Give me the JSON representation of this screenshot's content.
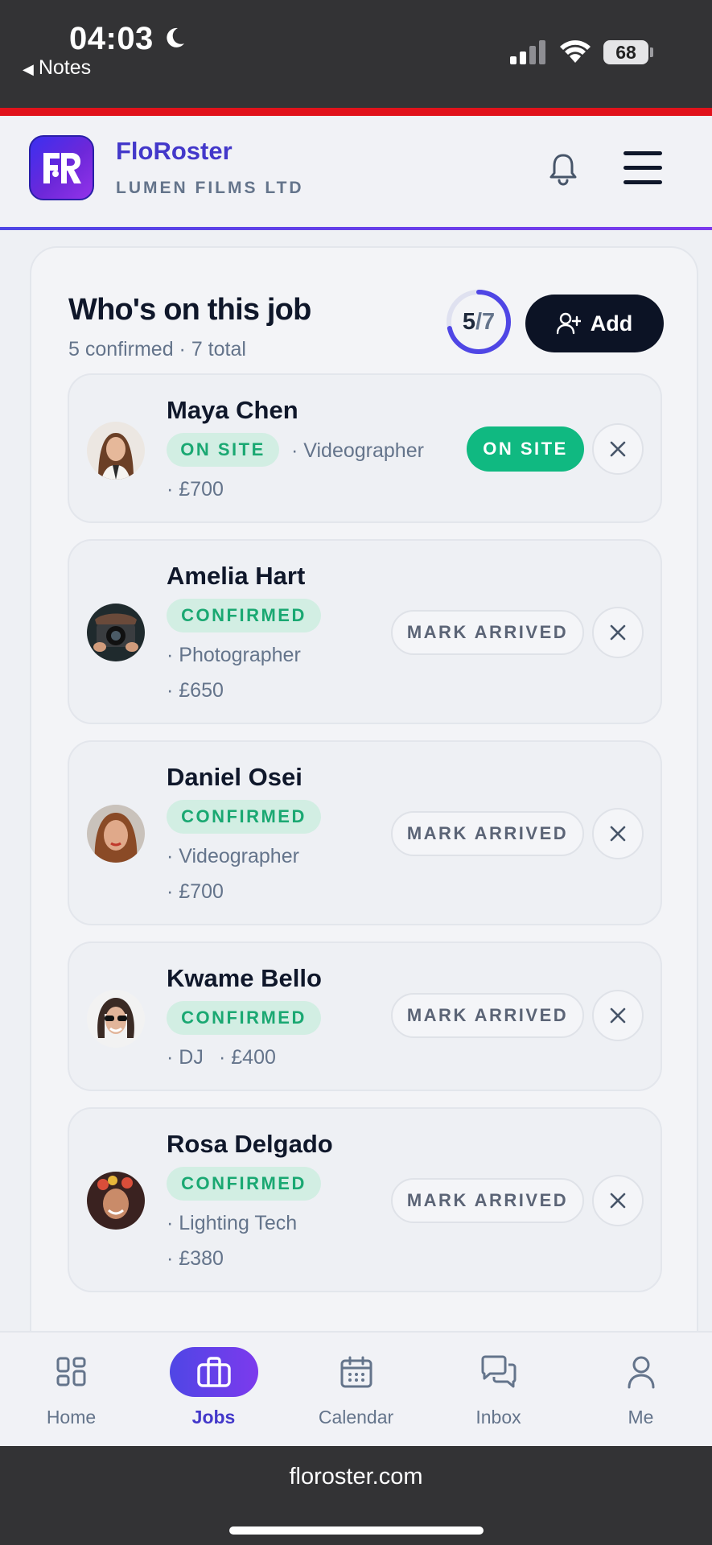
{
  "status_bar": {
    "time": "04:03",
    "back_app": "Notes",
    "battery": "68"
  },
  "header": {
    "brand": "FloRoster",
    "company": "LUMEN FILMS LTD",
    "logo_text": "FR",
    "accent": "#4f46e5"
  },
  "card": {
    "title": "Who's on this job",
    "subtitle": "5 confirmed · 7 total",
    "progress_confirmed": "5",
    "progress_total": "7",
    "progress_fraction": 0.714,
    "add_label": "Add"
  },
  "crew": [
    {
      "name": "Maya Chen",
      "status": "ON SITE",
      "role": "· Videographer",
      "rate": "· £700",
      "action": "ON SITE"
    },
    {
      "name": "Amelia Hart",
      "status": "CONFIRMED",
      "role": "· Photographer",
      "rate": "· £650",
      "action": "MARK ARRIVED"
    },
    {
      "name": "Daniel Osei",
      "status": "CONFIRMED",
      "role": "· Videographer",
      "rate": "· £700",
      "action": "MARK ARRIVED"
    },
    {
      "name": "Kwame Bello",
      "status": "CONFIRMED",
      "role": "· DJ",
      "rate": "· £400",
      "action": "MARK ARRIVED"
    },
    {
      "name": "Rosa Delgado",
      "status": "CONFIRMED",
      "role": "· Lighting Tech",
      "rate": "· £380",
      "action": "MARK ARRIVED"
    }
  ],
  "nav": {
    "home": "Home",
    "jobs": "Jobs",
    "calendar": "Calendar",
    "inbox": "Inbox",
    "me": "Me",
    "active": "jobs"
  },
  "browser": {
    "url": "floroster.com"
  },
  "colors": {
    "success": "#10b981",
    "success_bg": "#d2eee3",
    "dark_button": "#0c1325"
  }
}
